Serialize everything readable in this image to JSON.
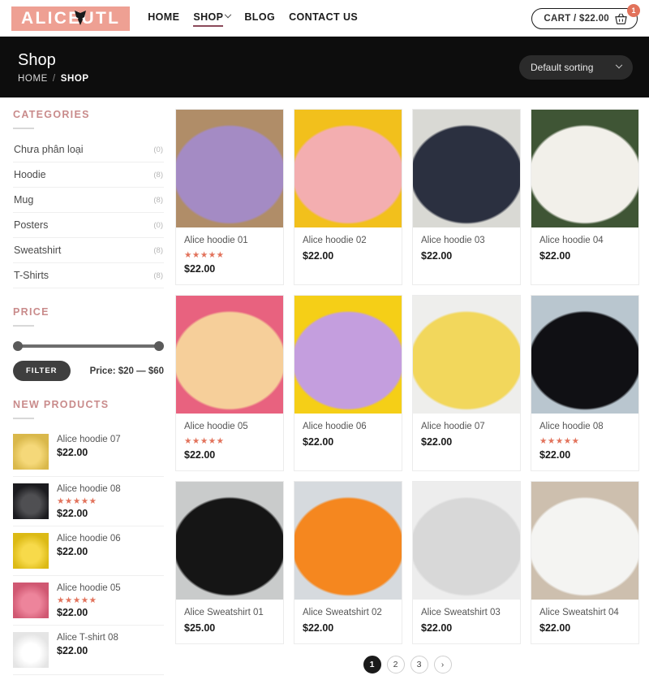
{
  "header": {
    "logo_text_left": "ALICE",
    "logo_text_right": "UTL",
    "logo_bg": "#eea093",
    "nav": [
      {
        "label": "HOME",
        "active": false,
        "has_caret": false
      },
      {
        "label": "SHOP",
        "active": true,
        "has_caret": true
      },
      {
        "label": "BLOG",
        "active": false,
        "has_caret": false
      },
      {
        "label": "CONTACT US",
        "active": false,
        "has_caret": false
      }
    ],
    "cart_label": "CART / $22.00",
    "cart_badge": "1"
  },
  "pagehead": {
    "title": "Shop",
    "breadcrumb_home": "HOME",
    "breadcrumb_sep": "/",
    "breadcrumb_current": "SHOP",
    "sorting_value": "Default sorting"
  },
  "sidebar": {
    "categories_title": "CATEGORIES",
    "categories": [
      {
        "name": "Chưa phân loại",
        "count": "(0)"
      },
      {
        "name": "Hoodie",
        "count": "(8)"
      },
      {
        "name": "Mug",
        "count": "(8)"
      },
      {
        "name": "Posters",
        "count": "(0)"
      },
      {
        "name": "Sweatshirt",
        "count": "(8)"
      },
      {
        "name": "T-Shirts",
        "count": "(8)"
      }
    ],
    "price_title": "PRICE",
    "filter_button": "FILTER",
    "price_label": "Price: $20 — $60",
    "price_min": "$20",
    "price_max": "$60",
    "new_products_title": "NEW PRODUCTS",
    "new_products": [
      {
        "name": "Alice hoodie 07",
        "price": "$22.00",
        "stars": "",
        "color": "#f2cd53"
      },
      {
        "name": "Alice hoodie 08",
        "price": "$22.00",
        "stars": "★★★★★",
        "color": "#1e1e22"
      },
      {
        "name": "Alice hoodie 06",
        "price": "$22.00",
        "stars": "",
        "color": "#f5cf17"
      },
      {
        "name": "Alice hoodie 05",
        "price": "$22.00",
        "stars": "★★★★★",
        "color": "#e8627f"
      },
      {
        "name": "Alice T-shirt 08",
        "price": "$22.00",
        "stars": "",
        "color": "#ffffff"
      }
    ]
  },
  "products": [
    {
      "name": "Alice hoodie 01",
      "price": "$22.00",
      "stars": "★★★★★",
      "bg": "#b08d68",
      "item": "#a48bc4"
    },
    {
      "name": "Alice hoodie 02",
      "price": "$22.00",
      "stars": "",
      "bg": "#f2c01c",
      "item": "#f3aeb0"
    },
    {
      "name": "Alice hoodie 03",
      "price": "$22.00",
      "stars": "",
      "bg": "#d9d9d4",
      "item": "#2b3040"
    },
    {
      "name": "Alice hoodie 04",
      "price": "$22.00",
      "stars": "",
      "bg": "#3f5535",
      "item": "#f2f0ea"
    },
    {
      "name": "Alice hoodie 05",
      "price": "$22.00",
      "stars": "★★★★★",
      "bg": "#e8627f",
      "item": "#f6cf9a"
    },
    {
      "name": "Alice hoodie 06",
      "price": "$22.00",
      "stars": "",
      "bg": "#f5cf17",
      "item": "#c49ede"
    },
    {
      "name": "Alice hoodie 07",
      "price": "$22.00",
      "stars": "",
      "bg": "#eeeeec",
      "item": "#f2d75c"
    },
    {
      "name": "Alice hoodie 08",
      "price": "$22.00",
      "stars": "★★★★★",
      "bg": "#b9c6cf",
      "item": "#101014"
    },
    {
      "name": "Alice Sweatshirt 01",
      "price": "$25.00",
      "stars": "",
      "bg": "#c9cbcb",
      "item": "#151515"
    },
    {
      "name": "Alice Sweatshirt 02",
      "price": "$22.00",
      "stars": "",
      "bg": "#d6dade",
      "item": "#f5871f"
    },
    {
      "name": "Alice Sweatshirt 03",
      "price": "$22.00",
      "stars": "",
      "bg": "#ededed",
      "item": "#d8d8d8"
    },
    {
      "name": "Alice Sweatshirt 04",
      "price": "$22.00",
      "stars": "",
      "bg": "#cdbfae",
      "item": "#f4f4f2"
    }
  ],
  "pagination": {
    "pages": [
      "1",
      "2",
      "3"
    ],
    "active": "1",
    "next_icon": "›"
  },
  "colors": {
    "accent_pink": "#c98b8b",
    "star": "#e2725b",
    "dark": "#0d0d0d"
  }
}
